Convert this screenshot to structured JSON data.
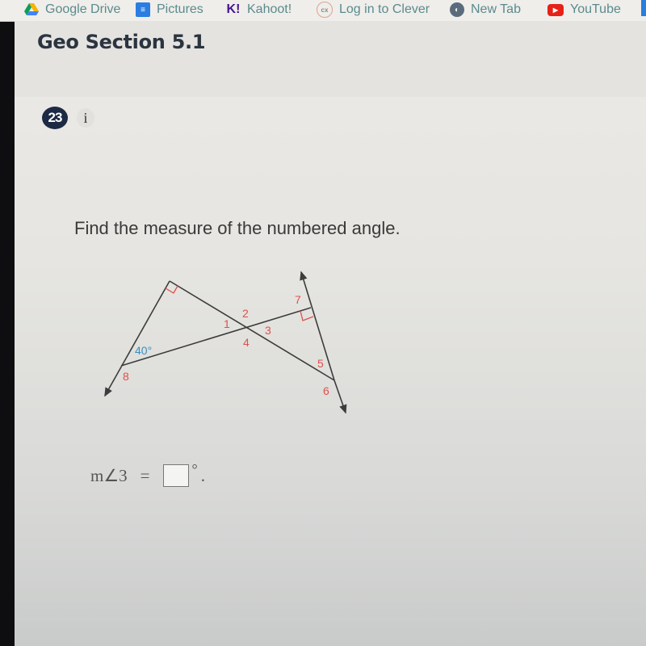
{
  "bookmarks": [
    {
      "label": "Google Drive",
      "icon": "google-drive-icon"
    },
    {
      "label": "Pictures",
      "icon": "docs-icon"
    },
    {
      "label": "Kahoot!",
      "icon": "kahoot-icon"
    },
    {
      "label": "Log in to Clever",
      "icon": "clever-icon"
    },
    {
      "label": "New Tab",
      "icon": "globe-icon"
    },
    {
      "label": "YouTube",
      "icon": "youtube-icon"
    }
  ],
  "header": {
    "title": "Geo Section 5.1"
  },
  "question": {
    "number": "23",
    "info_label": "i",
    "prompt": "Find the measure of the numbered angle."
  },
  "diagram": {
    "given_angle": "40°",
    "angle_labels": [
      "1",
      "2",
      "3",
      "4",
      "5",
      "6",
      "7",
      "8"
    ],
    "right_angles": 2,
    "colors": {
      "line": "#3c3c3c",
      "label": "#e0504a",
      "given": "#3a8fc0"
    }
  },
  "answer": {
    "prefix": "m∠3",
    "equals": "=",
    "value": "",
    "degree": "°",
    "suffix": "."
  }
}
